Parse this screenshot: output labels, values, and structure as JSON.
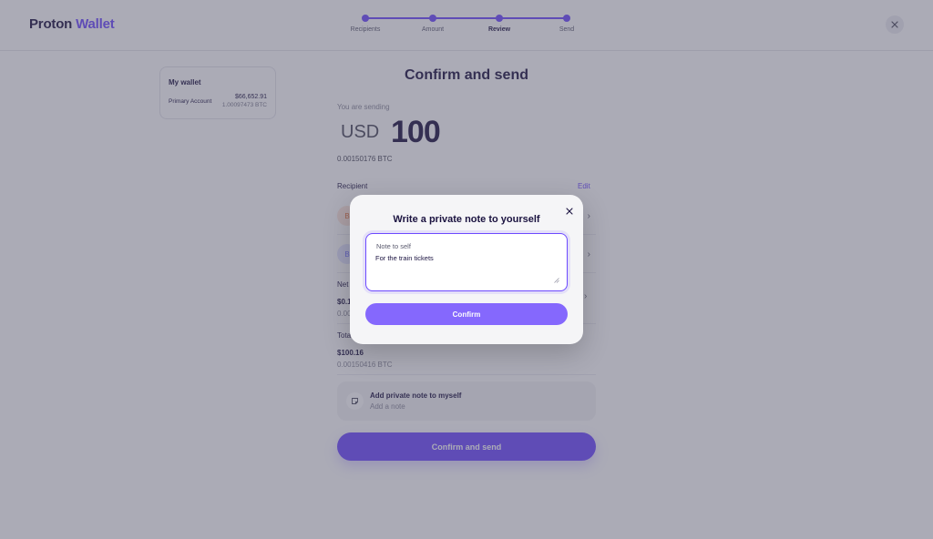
{
  "header": {
    "logo_part1": "Proton",
    "logo_part2": "Wallet",
    "steps": [
      {
        "label": "Recipients",
        "active": false
      },
      {
        "label": "Amount",
        "active": false
      },
      {
        "label": "Review",
        "active": true
      },
      {
        "label": "Send",
        "active": false
      }
    ]
  },
  "wallet": {
    "title": "My wallet",
    "account_name": "Primary Account",
    "fiat_balance": "$66,652.91",
    "btc_balance": "1.00097473 BTC"
  },
  "main": {
    "title": "Confirm and send",
    "sending_label": "You are sending",
    "currency": "USD",
    "amount": "100",
    "amount_btc": "0.00150176 BTC",
    "recipient_label": "Recipient",
    "edit_label": "Edit",
    "recipients": [
      {
        "initial": "B",
        "avatar_bg": "#fde6dd",
        "avatar_fg": "#e2703a"
      },
      {
        "initial": "B",
        "avatar_bg": "#e3e4ff",
        "avatar_fg": "#6d6dff"
      }
    ],
    "network_fee_label": "Net",
    "network_fee_value": "$0.1",
    "network_fee_btc": "0.00",
    "total_label": "Tota",
    "total_value": "$100.16",
    "total_btc": "0.00150416 BTC",
    "note_title": "Add private note to myself",
    "note_sub": "Add a note",
    "send_button": "Confirm and send"
  },
  "modal": {
    "title": "Write a private note to yourself",
    "field_label": "Note to self",
    "field_value": "For the train tickets",
    "confirm_button": "Confirm"
  },
  "colors": {
    "accent": "#6d4aff",
    "text": "#1b1340"
  },
  "icons": {
    "close": "close-icon",
    "chevron": "chevron-right-icon",
    "note": "note-icon"
  }
}
